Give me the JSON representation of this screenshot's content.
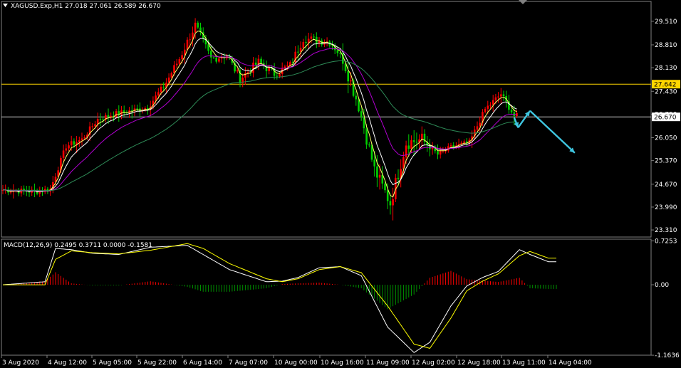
{
  "window": {
    "symbol_header": "XAGUSD.Exp,H1  27.018 27.061 26.589 26.670",
    "macd_header": "MACD(12,26,9) 0.2495 0.3711 0.0000 -0.1581"
  },
  "colors": {
    "background": "#000000",
    "frame": "#808080",
    "text": "#ffffff",
    "bull_candle": "#ff0000",
    "bear_candle": "#00d000",
    "ma_fast": "#ffff66",
    "ma_mid": "#ffffff",
    "ma_slow": "#b000d0",
    "ma_long": "#2e8b57",
    "hline": "#ffd700",
    "forecast_arrow": "#3fc6e0",
    "macd_pos": "#ff0000",
    "macd_neg": "#009000",
    "macd_line": "#ffffff",
    "signal_line": "#ffff00"
  },
  "chart_data": [
    {
      "type": "candlestick",
      "title": "XAGUSD.Exp,H1",
      "ylim": [
        23.1,
        30.1
      ],
      "y_ticks": [
        "29.510",
        "28.810",
        "28.130",
        "27.430",
        "26.750",
        "26.050",
        "25.370",
        "24.670",
        "23.990",
        "23.310"
      ],
      "y_tick_values": [
        29.51,
        28.81,
        28.13,
        27.43,
        26.75,
        26.05,
        25.37,
        24.67,
        23.99,
        23.31
      ],
      "x_ticks": [
        "3 Aug 2020",
        "4 Aug 12:00",
        "5 Aug 05:00",
        "5 Aug 22:00",
        "6 Aug 14:00",
        "7 Aug 07:00",
        "10 Aug 00:00",
        "10 Aug 16:00",
        "11 Aug 09:00",
        "12 Aug 02:00",
        "12 Aug 18:00",
        "13 Aug 11:00",
        "14 Aug 04:00"
      ],
      "price_labels": [
        {
          "text": "27.642",
          "value": 27.642,
          "style": "yellow-tag"
        },
        {
          "text": "26.670",
          "value": 26.67,
          "style": "white-tag"
        }
      ],
      "horizontal_lines": [
        27.642,
        26.67
      ],
      "path_anchors": [
        {
          "i": 0,
          "p": 24.5
        },
        {
          "i": 12,
          "p": 24.45
        },
        {
          "i": 18,
          "p": 24.52
        },
        {
          "i": 24,
          "p": 25.8
        },
        {
          "i": 30,
          "p": 26.0
        },
        {
          "i": 36,
          "p": 26.6
        },
        {
          "i": 42,
          "p": 26.75
        },
        {
          "i": 55,
          "p": 26.95
        },
        {
          "i": 62,
          "p": 27.7
        },
        {
          "i": 67,
          "p": 28.4
        },
        {
          "i": 73,
          "p": 29.4
        },
        {
          "i": 79,
          "p": 28.4
        },
        {
          "i": 85,
          "p": 28.5
        },
        {
          "i": 90,
          "p": 27.8
        },
        {
          "i": 97,
          "p": 28.3
        },
        {
          "i": 103,
          "p": 27.95
        },
        {
          "i": 109,
          "p": 28.2
        },
        {
          "i": 114,
          "p": 29.0
        },
        {
          "i": 124,
          "p": 28.9
        },
        {
          "i": 129,
          "p": 28.4
        },
        {
          "i": 135,
          "p": 27.0
        },
        {
          "i": 141,
          "p": 25.1
        },
        {
          "i": 147,
          "p": 24.1
        },
        {
          "i": 153,
          "p": 25.9
        },
        {
          "i": 159,
          "p": 26.0
        },
        {
          "i": 165,
          "p": 25.55
        },
        {
          "i": 171,
          "p": 25.8
        },
        {
          "i": 177,
          "p": 25.9
        },
        {
          "i": 183,
          "p": 26.9
        },
        {
          "i": 189,
          "p": 27.35
        },
        {
          "i": 194,
          "p": 26.7
        }
      ],
      "forecast_arrows": [
        {
          "from": [
            194,
            26.65
          ],
          "to": [
            195.5,
            26.35
          ]
        },
        {
          "from": [
            195.5,
            26.35
          ],
          "to": [
            200,
            26.85
          ]
        },
        {
          "from": [
            200,
            26.85
          ],
          "to": [
            217,
            25.6
          ]
        }
      ]
    },
    {
      "type": "bar",
      "title": "MACD(12,26,9)",
      "ylim": [
        -1.163,
        0.753
      ],
      "y_ticks": [
        "0.7253",
        "0.00",
        "-1.1636"
      ],
      "y_tick_values": [
        0.7253,
        0.0,
        -1.1636
      ],
      "series": [
        {
          "name": "MACD",
          "values": [
            0.0,
            0.05,
            0.6,
            0.58,
            0.52,
            0.5,
            0.62,
            0.65,
            0.5,
            0.25,
            0.05,
            0.06,
            0.12,
            0.28,
            0.3,
            0.15,
            -0.7,
            -1.12,
            -0.95,
            -0.35,
            -0.02,
            0.12,
            0.22,
            0.58,
            0.5,
            0.38
          ]
        },
        {
          "name": "Signal",
          "values": [
            0.0,
            0.0,
            0.42,
            0.56,
            0.53,
            0.51,
            0.57,
            0.68,
            0.6,
            0.35,
            0.1,
            0.05,
            0.1,
            0.25,
            0.3,
            0.2,
            -0.35,
            -0.98,
            -1.05,
            -0.55,
            -0.1,
            0.06,
            0.18,
            0.48,
            0.55,
            0.44
          ]
        }
      ],
      "macd_anchor_index": [
        0,
        16,
        20,
        26,
        34,
        44,
        56,
        70,
        76,
        86,
        100,
        106,
        112,
        120,
        128,
        136,
        146,
        156,
        162,
        170,
        176,
        182,
        188,
        196,
        200,
        207
      ]
    }
  ]
}
